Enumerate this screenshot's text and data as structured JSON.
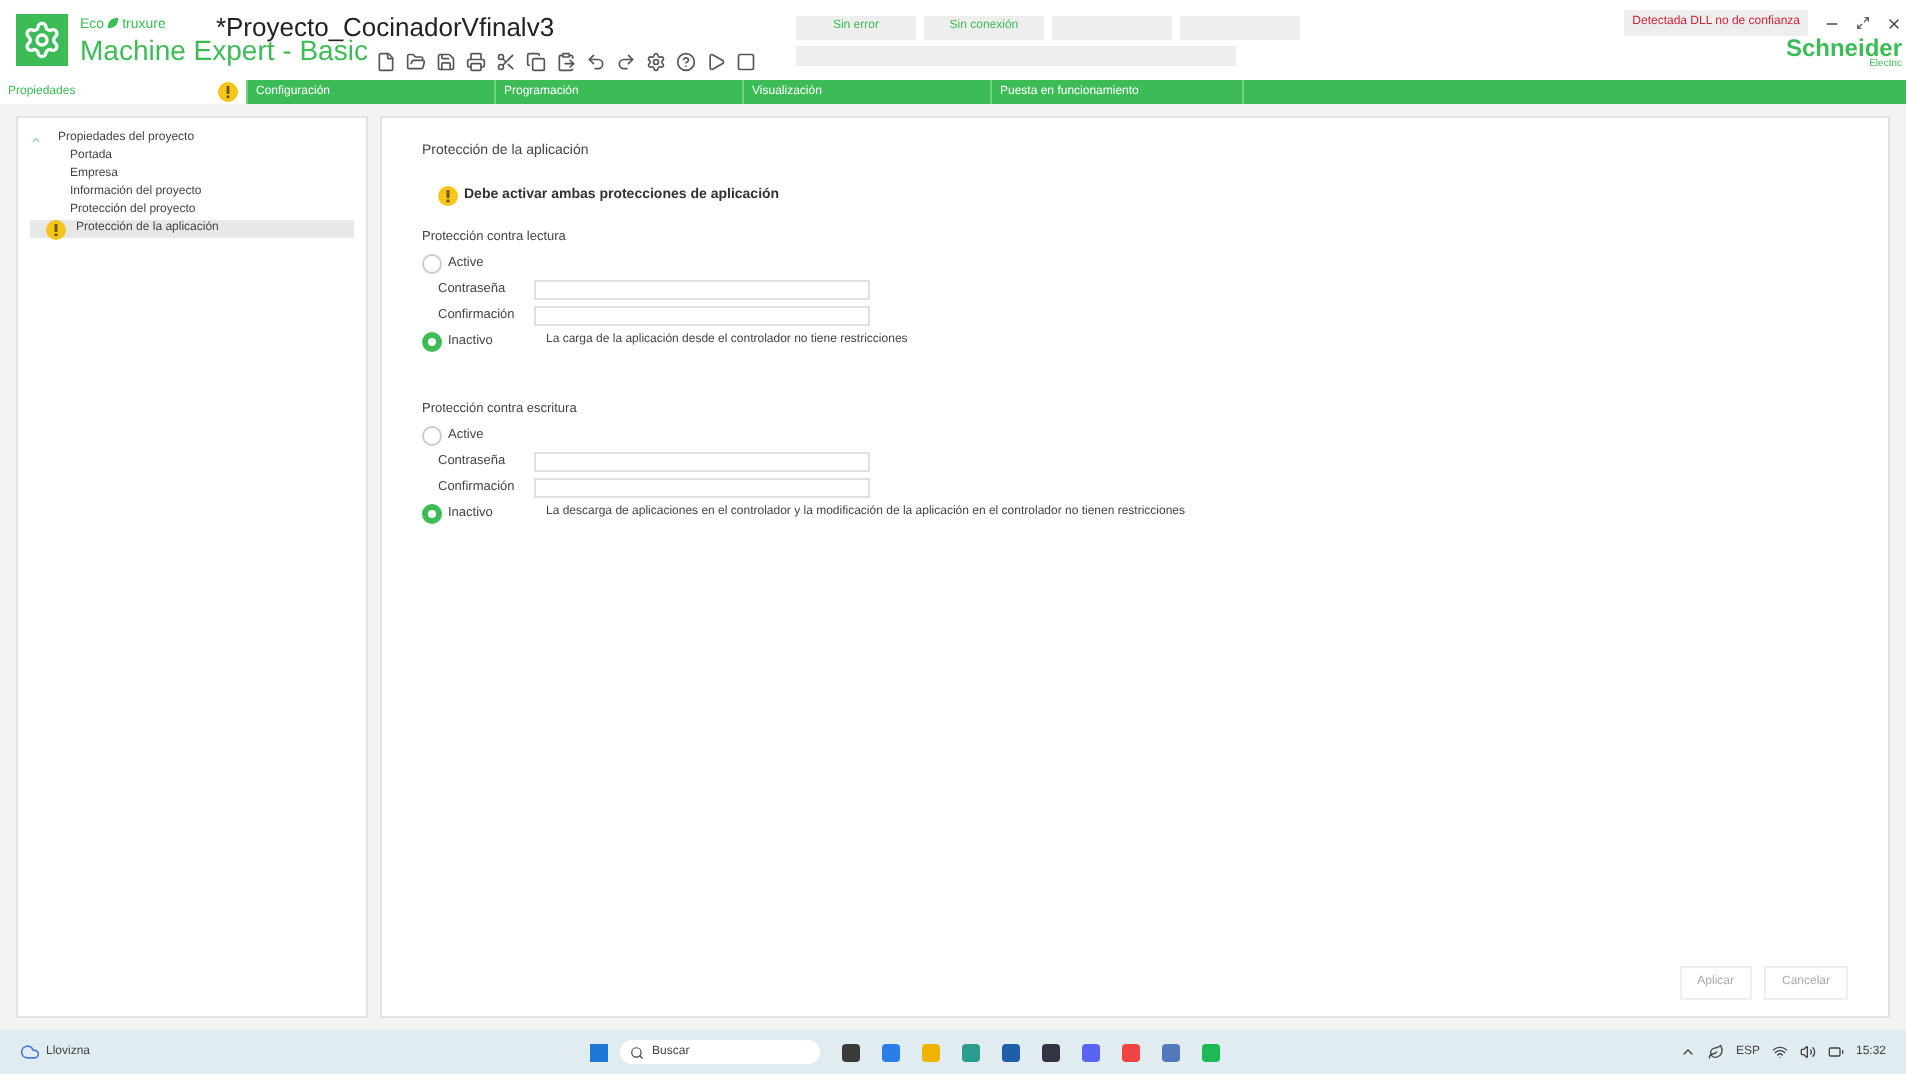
{
  "header": {
    "brand_top": "Eco",
    "brand_top2": "truxure",
    "product": "Machine Expert - Basic",
    "project_title": "*Proyecto_CocinadorVfinalv3",
    "status": [
      "Sin error",
      "Sin conexión"
    ],
    "alert": "Detectada DLL no de confianza",
    "vendor": "Schneider",
    "vendor_sub": "Electric"
  },
  "tabs": [
    {
      "label": "Propiedades",
      "selected": true,
      "warning": true
    },
    {
      "label": "Configuración",
      "selected": false,
      "warning": false
    },
    {
      "label": "Programación",
      "selected": false,
      "warning": false
    },
    {
      "label": "Visualización",
      "selected": false,
      "warning": false
    },
    {
      "label": "Puesta en funcionamiento",
      "selected": false,
      "warning": false
    }
  ],
  "tree": {
    "label": "Propiedades del proyecto",
    "expanded": true,
    "children": [
      {
        "label": "Portada",
        "selected": false,
        "warning": false
      },
      {
        "label": "Empresa",
        "selected": false,
        "warning": false
      },
      {
        "label": "Información del proyecto",
        "selected": false,
        "warning": false
      },
      {
        "label": "Protección del proyecto",
        "selected": false,
        "warning": false
      },
      {
        "label": "Protección de la aplicación",
        "selected": true,
        "warning": true
      }
    ]
  },
  "panel": {
    "title": "Protección de la aplicación",
    "warning": "Debe activar ambas protecciones de aplicación",
    "sections": [
      {
        "title": "Protección contra lectura",
        "options": [
          {
            "label": "Active",
            "selected": false
          },
          {
            "label": "Inactivo",
            "selected": true
          }
        ],
        "fields": [
          {
            "label": "Contraseña"
          },
          {
            "label": "Confirmación"
          }
        ],
        "description": "La carga de la aplicación desde el controlador no tiene restricciones"
      },
      {
        "title": "Protección contra escritura",
        "options": [
          {
            "label": "Active",
            "selected": false
          },
          {
            "label": "Inactivo",
            "selected": true
          }
        ],
        "fields": [
          {
            "label": "Contraseña"
          },
          {
            "label": "Confirmación"
          }
        ],
        "description": "La descarga de aplicaciones en el controlador y la modificación de la aplicación en el controlador no tienen restricciones"
      }
    ],
    "buttons": [
      {
        "label": "Aplicar",
        "disabled": true
      },
      {
        "label": "Cancelar",
        "disabled": true
      }
    ]
  },
  "taskbar": {
    "weather": "Llovizna",
    "search": "Buscar",
    "language": "ESP",
    "time": "15:32"
  }
}
